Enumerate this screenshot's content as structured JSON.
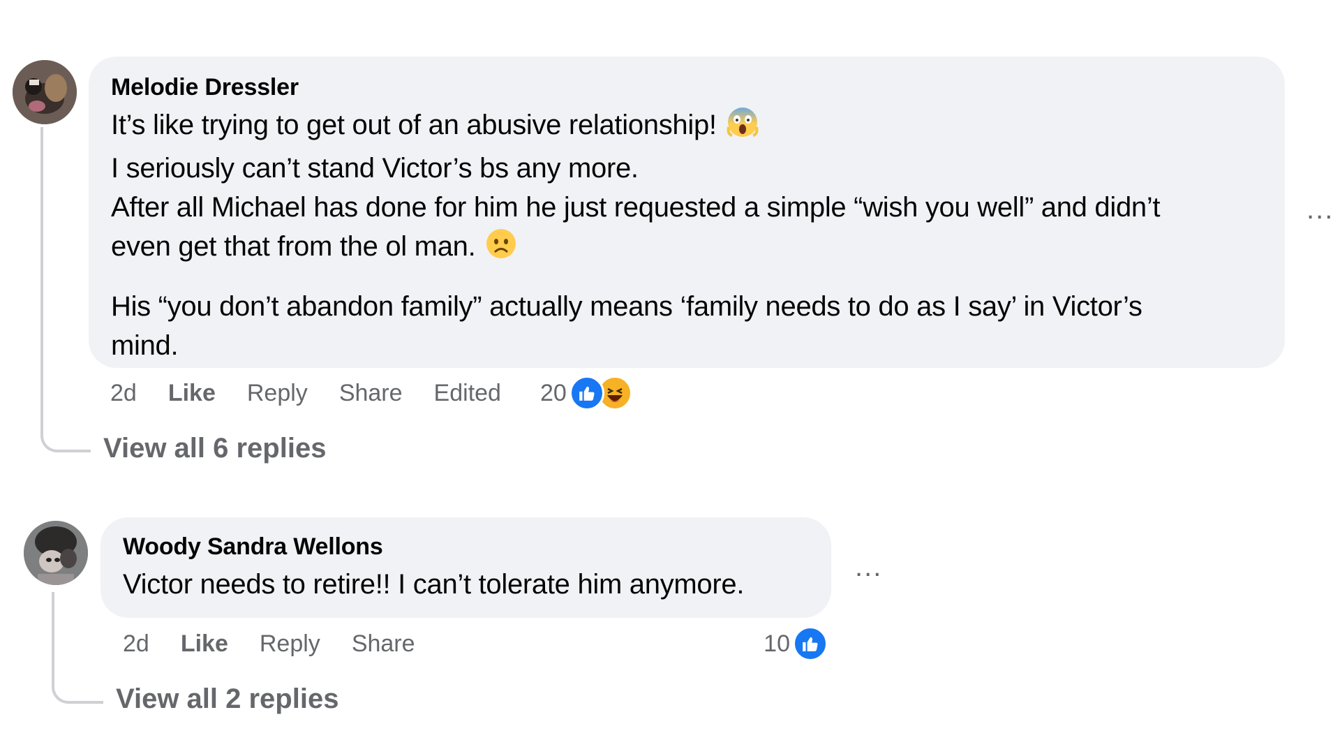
{
  "comments": [
    {
      "author": "Melodie Dressler",
      "lines": [
        "It’s like trying to get out of an abusive relationship!",
        "I seriously can’t stand Victor’s bs any more.",
        "After all Michael has done for him he just requested a simple “wish you well” and didn’t",
        "even get that from the ol man.",
        "His “you don’t abandon family” actually means ‘family needs to do as I say’ in Victor’s",
        "mind."
      ],
      "emojis": [
        "screaming-face-emoji",
        "frowning-face-emoji"
      ],
      "more_label": "...",
      "time": "2d",
      "like_label": "Like",
      "reply_label": "Reply",
      "share_label": "Share",
      "edited_label": "Edited",
      "reaction_count": "20",
      "reactions": [
        "like",
        "haha"
      ],
      "view_replies": "View all 6 replies"
    },
    {
      "author": "Woody Sandra Wellons",
      "lines": [
        "Victor needs to retire!! I can’t tolerate him anymore."
      ],
      "more_label": "...",
      "time": "2d",
      "like_label": "Like",
      "reply_label": "Reply",
      "share_label": "Share",
      "reaction_count": "10",
      "reactions": [
        "like"
      ],
      "view_replies": "View all 2 replies"
    }
  ],
  "colors": {
    "bubble": "#f0f2f5",
    "meta_text": "#65676b",
    "like_blue": "#1877f2",
    "haha_yellow": "#f7b125",
    "thread_line": "#ced0d4"
  }
}
